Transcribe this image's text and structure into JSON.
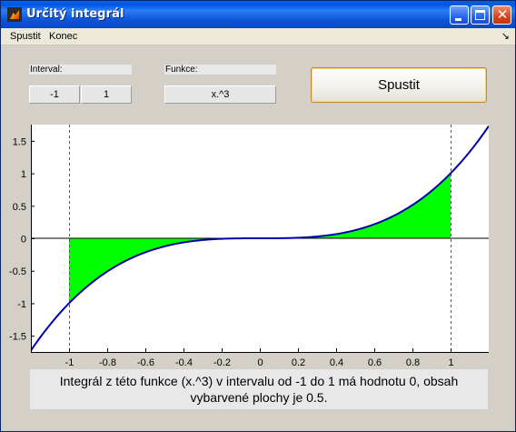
{
  "window": {
    "title": "Určitý integrál",
    "minimize_icon": "minimize-icon",
    "maximize_icon": "maximize-icon",
    "close_glyph": "✕"
  },
  "menu": {
    "items": [
      "Spustit",
      "Konec"
    ],
    "dock_glyph": "↘"
  },
  "controls": {
    "interval_label": "Interval:",
    "function_label": "Funkce:",
    "interval_from": "-1",
    "interval_to": "1",
    "function": "x.^3",
    "run_button": "Spustit"
  },
  "result": {
    "line1": "Integrál z této funkce (x.^3) v intervalu od -1 do 1 má hodnotu 0, obsah",
    "line2": "vybarvené plochy je 0.5."
  },
  "colors": {
    "curve": "#0000a8",
    "fill": "#00ff00",
    "window_bg": "#d4d0c8",
    "title_bar": "#0058e6"
  },
  "chart_data": {
    "type": "line",
    "function": "x.^3",
    "x_range": [
      -1.2,
      1.2
    ],
    "xlim": [
      -1.2,
      1.2
    ],
    "ylim": [
      -1.75,
      1.75
    ],
    "shaded_interval": [
      -1,
      1
    ],
    "xticks": [
      -1,
      -0.8,
      -0.6,
      -0.4,
      -0.2,
      0,
      0.2,
      0.4,
      0.6,
      0.8,
      1
    ],
    "xtick_labels": [
      "-1",
      "-0.8",
      "-0.6",
      "-0.4",
      "-0.2",
      "0",
      "0.2",
      "0.4",
      "0.6",
      "0.8",
      "1"
    ],
    "yticks": [
      1.5,
      1,
      0.5,
      0,
      -0.5,
      -1,
      -1.5
    ],
    "ytick_labels": [
      "1.5",
      "1",
      "0.5",
      "0",
      "-0.5",
      "-1",
      "-1.5"
    ],
    "vertical_markers": [
      -1,
      1
    ],
    "grid": false
  }
}
